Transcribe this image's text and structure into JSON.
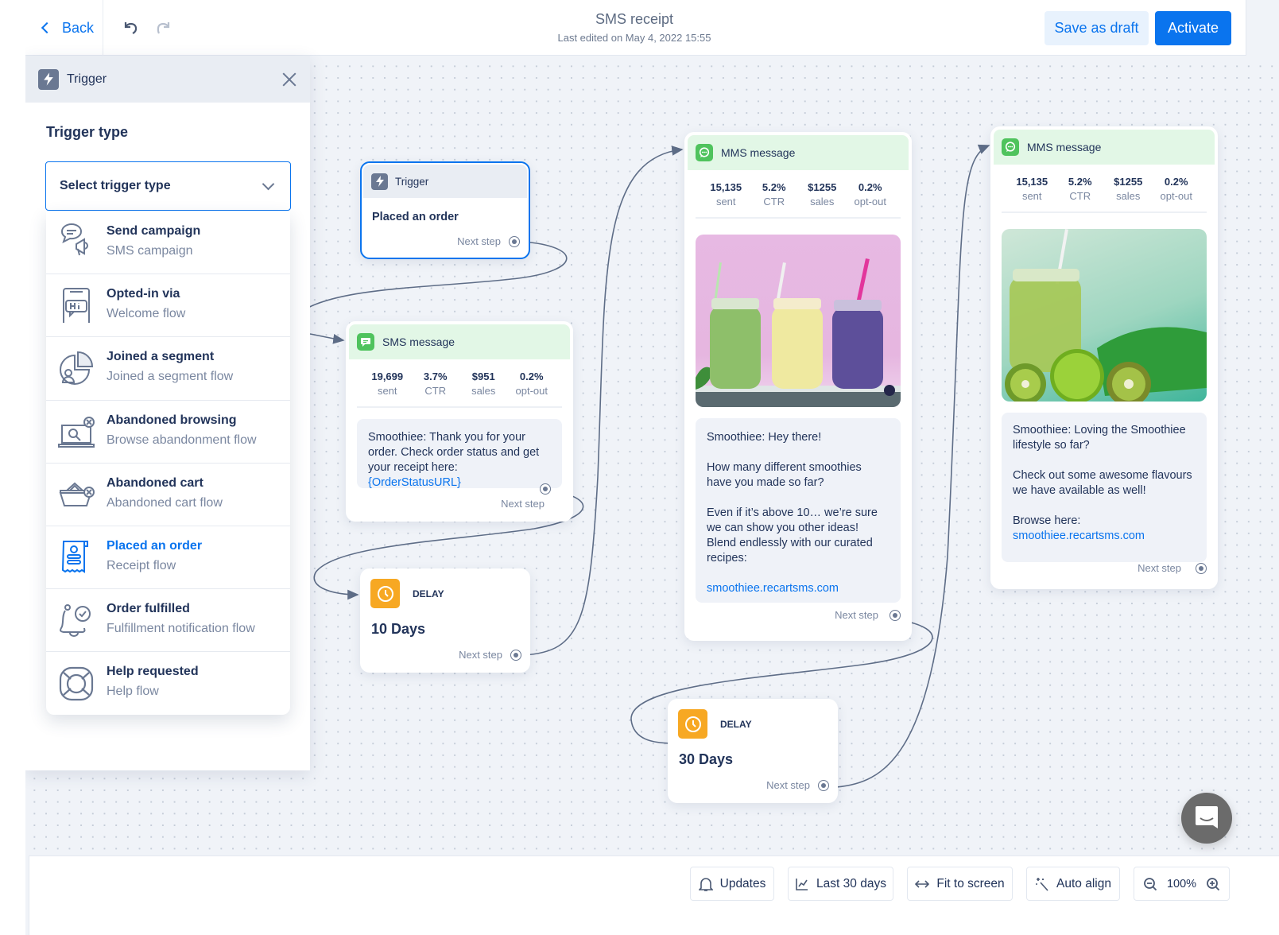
{
  "header": {
    "back_label": "Back",
    "title": "SMS receipt",
    "subtitle": "Last edited on May 4, 2022 15:55",
    "save_draft_label": "Save as draft",
    "activate_label": "Activate"
  },
  "panel": {
    "title": "Trigger",
    "section_label": "Trigger type",
    "select_placeholder": "Select trigger type",
    "options": [
      {
        "title": "Send campaign",
        "subtitle": "SMS campaign",
        "icon": "megaphone-chat-icon"
      },
      {
        "title": "Opted-in via",
        "subtitle": "Welcome flow",
        "icon": "phone-hi-icon"
      },
      {
        "title": "Joined a segment",
        "subtitle": "Joined a segment flow",
        "icon": "pie-person-icon"
      },
      {
        "title": "Abandoned browsing",
        "subtitle": "Browse abandonment flow",
        "icon": "laptop-search-icon"
      },
      {
        "title": "Abandoned cart",
        "subtitle": "Abandoned cart flow",
        "icon": "basket-x-icon"
      },
      {
        "title": "Placed an order",
        "subtitle": "Receipt flow",
        "icon": "receipt-icon",
        "selected": true
      },
      {
        "title": "Order fulfilled",
        "subtitle": "Fulfillment notification flow",
        "icon": "bell-check-icon"
      },
      {
        "title": "Help requested",
        "subtitle": "Help flow",
        "icon": "lifebuoy-icon"
      }
    ]
  },
  "flow": {
    "next_step_label": "Next step",
    "trigger_node": {
      "header": "Trigger",
      "value": "Placed an order"
    },
    "sms_node": {
      "header": "SMS message",
      "stats": [
        {
          "value": "19,699",
          "label": "sent"
        },
        {
          "value": "3.7%",
          "label": "CTR"
        },
        {
          "value": "$951",
          "label": "sales"
        },
        {
          "value": "0.2%",
          "label": "opt-out"
        }
      ],
      "message_text": "Smoothiee: Thank you for your order. Check order status and get your receipt here: ",
      "message_link": "{OrderStatusURL}"
    },
    "delay_1": {
      "label": "DELAY",
      "value": "10 Days"
    },
    "mms_1": {
      "header": "MMS message",
      "stats": [
        {
          "value": "15,135",
          "label": "sent"
        },
        {
          "value": "5.2%",
          "label": "CTR"
        },
        {
          "value": "$1255",
          "label": "sales"
        },
        {
          "value": "0.2%",
          "label": "opt-out"
        }
      ],
      "image_alt": "Three smoothie jars: green, yellow, purple",
      "paragraphs": [
        "Smoothiee: Hey there!",
        "How many different smoothies have you made so far?",
        "Even if it’s above 10… we’re sure we can show you other ideas! Blend endlessly with our curated recipes:"
      ],
      "link": "smoothiee.recartsms.com"
    },
    "delay_2": {
      "label": "DELAY",
      "value": "30 Days"
    },
    "mms_2": {
      "header": "MMS message",
      "stats": [
        {
          "value": "15,135",
          "label": "sent"
        },
        {
          "value": "5.2%",
          "label": "CTR"
        },
        {
          "value": "$1255",
          "label": "sales"
        },
        {
          "value": "0.2%",
          "label": "opt-out"
        }
      ],
      "image_alt": "Green smoothie with kiwis and limes",
      "paragraphs": [
        "Smoothiee: Loving the Smoothiee lifestyle so far?",
        "Check out some awesome flavours we have available as well!",
        "Browse here:"
      ],
      "link": "smoothiee.recartsms.com"
    }
  },
  "toolbar": {
    "updates_label": "Updates",
    "range_label": "Last 30 days",
    "fit_label": "Fit to screen",
    "align_label": "Auto align",
    "zoom_level": "100%"
  },
  "colors": {
    "accent": "#0a74ee",
    "sms_green": "#4fc35d",
    "delay_orange": "#f7a823",
    "text_dark": "#22345a",
    "text_muted": "#7a87a0"
  }
}
